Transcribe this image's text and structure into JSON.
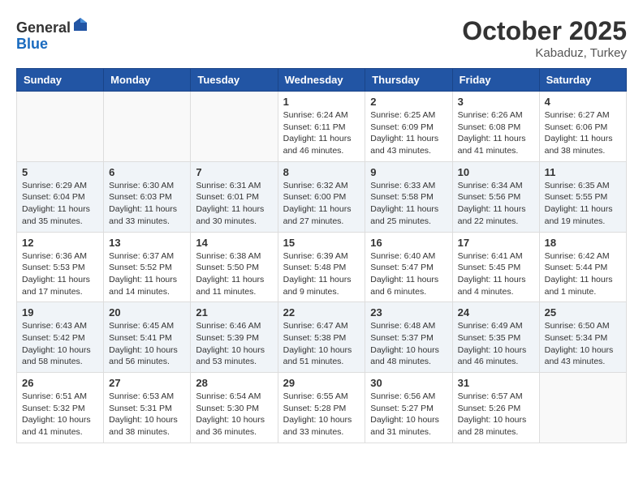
{
  "header": {
    "logo_general": "General",
    "logo_blue": "Blue",
    "month_title": "October 2025",
    "location": "Kabaduz, Turkey"
  },
  "days_of_week": [
    "Sunday",
    "Monday",
    "Tuesday",
    "Wednesday",
    "Thursday",
    "Friday",
    "Saturday"
  ],
  "weeks": [
    {
      "alt": false,
      "days": [
        {
          "num": "",
          "info": ""
        },
        {
          "num": "",
          "info": ""
        },
        {
          "num": "",
          "info": ""
        },
        {
          "num": "1",
          "info": "Sunrise: 6:24 AM\nSunset: 6:11 PM\nDaylight: 11 hours and 46 minutes."
        },
        {
          "num": "2",
          "info": "Sunrise: 6:25 AM\nSunset: 6:09 PM\nDaylight: 11 hours and 43 minutes."
        },
        {
          "num": "3",
          "info": "Sunrise: 6:26 AM\nSunset: 6:08 PM\nDaylight: 11 hours and 41 minutes."
        },
        {
          "num": "4",
          "info": "Sunrise: 6:27 AM\nSunset: 6:06 PM\nDaylight: 11 hours and 38 minutes."
        }
      ]
    },
    {
      "alt": true,
      "days": [
        {
          "num": "5",
          "info": "Sunrise: 6:29 AM\nSunset: 6:04 PM\nDaylight: 11 hours and 35 minutes."
        },
        {
          "num": "6",
          "info": "Sunrise: 6:30 AM\nSunset: 6:03 PM\nDaylight: 11 hours and 33 minutes."
        },
        {
          "num": "7",
          "info": "Sunrise: 6:31 AM\nSunset: 6:01 PM\nDaylight: 11 hours and 30 minutes."
        },
        {
          "num": "8",
          "info": "Sunrise: 6:32 AM\nSunset: 6:00 PM\nDaylight: 11 hours and 27 minutes."
        },
        {
          "num": "9",
          "info": "Sunrise: 6:33 AM\nSunset: 5:58 PM\nDaylight: 11 hours and 25 minutes."
        },
        {
          "num": "10",
          "info": "Sunrise: 6:34 AM\nSunset: 5:56 PM\nDaylight: 11 hours and 22 minutes."
        },
        {
          "num": "11",
          "info": "Sunrise: 6:35 AM\nSunset: 5:55 PM\nDaylight: 11 hours and 19 minutes."
        }
      ]
    },
    {
      "alt": false,
      "days": [
        {
          "num": "12",
          "info": "Sunrise: 6:36 AM\nSunset: 5:53 PM\nDaylight: 11 hours and 17 minutes."
        },
        {
          "num": "13",
          "info": "Sunrise: 6:37 AM\nSunset: 5:52 PM\nDaylight: 11 hours and 14 minutes."
        },
        {
          "num": "14",
          "info": "Sunrise: 6:38 AM\nSunset: 5:50 PM\nDaylight: 11 hours and 11 minutes."
        },
        {
          "num": "15",
          "info": "Sunrise: 6:39 AM\nSunset: 5:48 PM\nDaylight: 11 hours and 9 minutes."
        },
        {
          "num": "16",
          "info": "Sunrise: 6:40 AM\nSunset: 5:47 PM\nDaylight: 11 hours and 6 minutes."
        },
        {
          "num": "17",
          "info": "Sunrise: 6:41 AM\nSunset: 5:45 PM\nDaylight: 11 hours and 4 minutes."
        },
        {
          "num": "18",
          "info": "Sunrise: 6:42 AM\nSunset: 5:44 PM\nDaylight: 11 hours and 1 minute."
        }
      ]
    },
    {
      "alt": true,
      "days": [
        {
          "num": "19",
          "info": "Sunrise: 6:43 AM\nSunset: 5:42 PM\nDaylight: 10 hours and 58 minutes."
        },
        {
          "num": "20",
          "info": "Sunrise: 6:45 AM\nSunset: 5:41 PM\nDaylight: 10 hours and 56 minutes."
        },
        {
          "num": "21",
          "info": "Sunrise: 6:46 AM\nSunset: 5:39 PM\nDaylight: 10 hours and 53 minutes."
        },
        {
          "num": "22",
          "info": "Sunrise: 6:47 AM\nSunset: 5:38 PM\nDaylight: 10 hours and 51 minutes."
        },
        {
          "num": "23",
          "info": "Sunrise: 6:48 AM\nSunset: 5:37 PM\nDaylight: 10 hours and 48 minutes."
        },
        {
          "num": "24",
          "info": "Sunrise: 6:49 AM\nSunset: 5:35 PM\nDaylight: 10 hours and 46 minutes."
        },
        {
          "num": "25",
          "info": "Sunrise: 6:50 AM\nSunset: 5:34 PM\nDaylight: 10 hours and 43 minutes."
        }
      ]
    },
    {
      "alt": false,
      "days": [
        {
          "num": "26",
          "info": "Sunrise: 6:51 AM\nSunset: 5:32 PM\nDaylight: 10 hours and 41 minutes."
        },
        {
          "num": "27",
          "info": "Sunrise: 6:53 AM\nSunset: 5:31 PM\nDaylight: 10 hours and 38 minutes."
        },
        {
          "num": "28",
          "info": "Sunrise: 6:54 AM\nSunset: 5:30 PM\nDaylight: 10 hours and 36 minutes."
        },
        {
          "num": "29",
          "info": "Sunrise: 6:55 AM\nSunset: 5:28 PM\nDaylight: 10 hours and 33 minutes."
        },
        {
          "num": "30",
          "info": "Sunrise: 6:56 AM\nSunset: 5:27 PM\nDaylight: 10 hours and 31 minutes."
        },
        {
          "num": "31",
          "info": "Sunrise: 6:57 AM\nSunset: 5:26 PM\nDaylight: 10 hours and 28 minutes."
        },
        {
          "num": "",
          "info": ""
        }
      ]
    }
  ]
}
